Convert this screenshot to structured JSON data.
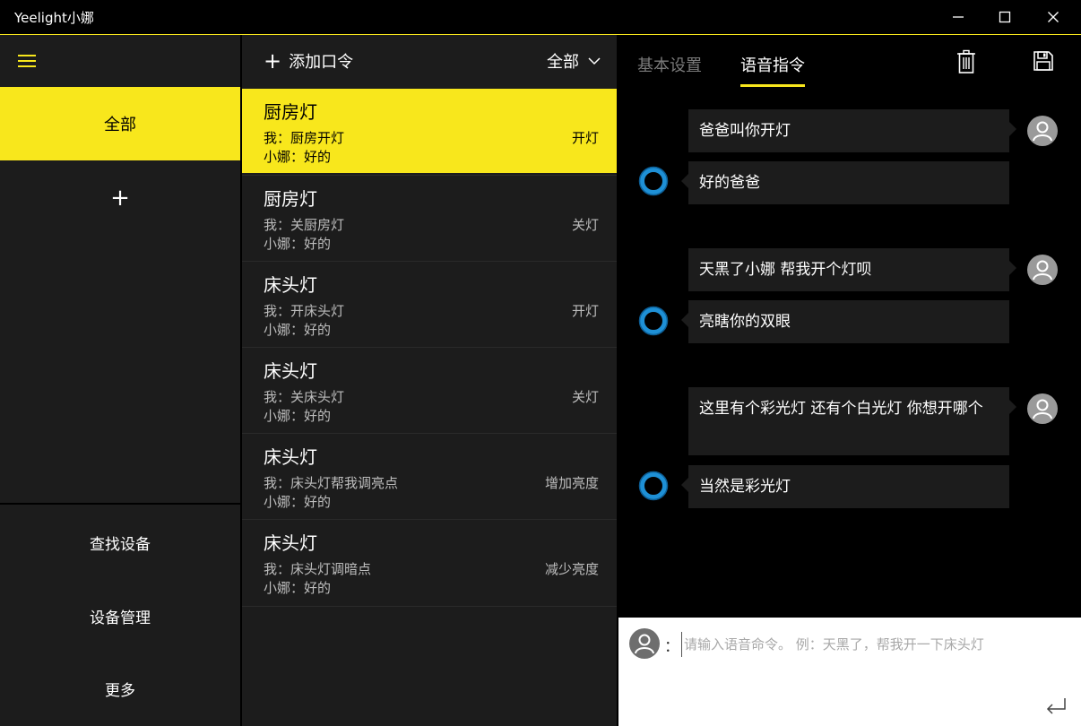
{
  "window": {
    "title": "Yeelight小娜"
  },
  "sidebar": {
    "categories": [
      {
        "label": "全部"
      }
    ],
    "add_label": "+",
    "nav": [
      {
        "label": "查找设备"
      },
      {
        "label": "设备管理"
      },
      {
        "label": "更多"
      }
    ]
  },
  "commands": {
    "add_label": "添加口令",
    "filter_label": "全部",
    "items": [
      {
        "name": "厨房灯",
        "me": "我：厨房开灯",
        "reply": "小娜：好的",
        "action": "开灯"
      },
      {
        "name": "厨房灯",
        "me": "我：关厨房灯",
        "reply": "小娜：好的",
        "action": "关灯"
      },
      {
        "name": "床头灯",
        "me": "我：开床头灯",
        "reply": "小娜：好的",
        "action": "开灯"
      },
      {
        "name": "床头灯",
        "me": "我：关床头灯",
        "reply": "小娜：好的",
        "action": "关灯"
      },
      {
        "name": "床头灯",
        "me": "我：床头灯帮我调亮点",
        "reply": "小娜：好的",
        "action": "增加亮度"
      },
      {
        "name": "床头灯",
        "me": "我：床头灯调暗点",
        "reply": "小娜：好的",
        "action": "减少亮度"
      }
    ]
  },
  "right": {
    "tabs": [
      {
        "label": "基本设置"
      },
      {
        "label": "语音指令"
      }
    ],
    "chat": [
      {
        "role": "user",
        "text": "爸爸叫你开灯"
      },
      {
        "role": "bot",
        "text": "好的爸爸"
      },
      {
        "role": "user",
        "text": "天黑了小娜 帮我开个灯呗"
      },
      {
        "role": "bot",
        "text": "亮瞎你的双眼"
      },
      {
        "role": "user",
        "text": "这里有个彩光灯 还有个白光灯 你想开哪个"
      },
      {
        "role": "bot",
        "text": "当然是彩光灯"
      }
    ],
    "input": {
      "prompt": "：",
      "placeholder": "请输入语音命令。 例：天黑了，帮我开一下床头灯",
      "value": ""
    }
  },
  "colors": {
    "accent": "#f8e71c",
    "panel": "#1c1c1c",
    "background": "#000000",
    "bot_ring": "#1e90d6"
  }
}
